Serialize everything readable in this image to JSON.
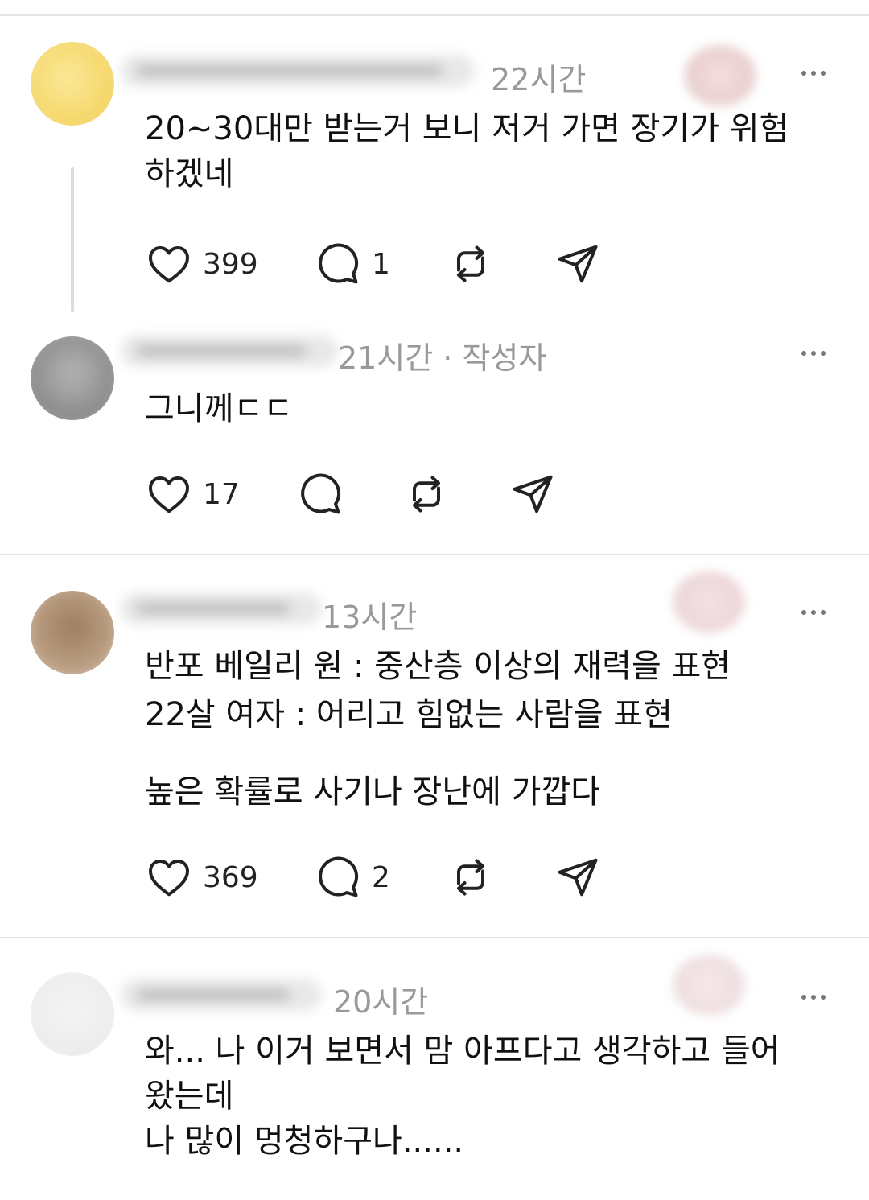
{
  "comments": [
    {
      "timestamp": "22시간",
      "author_tag": "",
      "text_lines": [
        "20~30대만 받는거 보니 저거 가면 장기가 위험",
        "하겠네"
      ],
      "likes": "399",
      "replies": "1"
    },
    {
      "timestamp": "21시간",
      "author_tag": "작성자",
      "text_lines": [
        "그니께ㄷㄷ"
      ],
      "likes": "17",
      "replies": ""
    },
    {
      "timestamp": "13시간",
      "author_tag": "",
      "text_lines": [
        "반포 베일리 원 : 중산층 이상의 재력을 표현",
        "22살 여자 : 어리고 힘없는 사람을 표현",
        "",
        "높은 확률로 사기나 장난에 가깝다"
      ],
      "likes": "369",
      "replies": "2"
    },
    {
      "timestamp": "20시간",
      "author_tag": "",
      "text_lines": [
        "와... 나 이거 보면서 맘 아프다고 생각하고 들어",
        "왔는데",
        "나 많이 멍청하구나......"
      ],
      "likes": "",
      "replies": ""
    }
  ],
  "icons": {
    "like": "heart-icon",
    "reply": "speech-bubble-icon",
    "repost": "repost-icon",
    "share": "send-icon",
    "more": "more-dots-icon"
  },
  "colors": {
    "meta_text": "#999999",
    "divider": "#e4e4e4",
    "icon": "#222222"
  }
}
